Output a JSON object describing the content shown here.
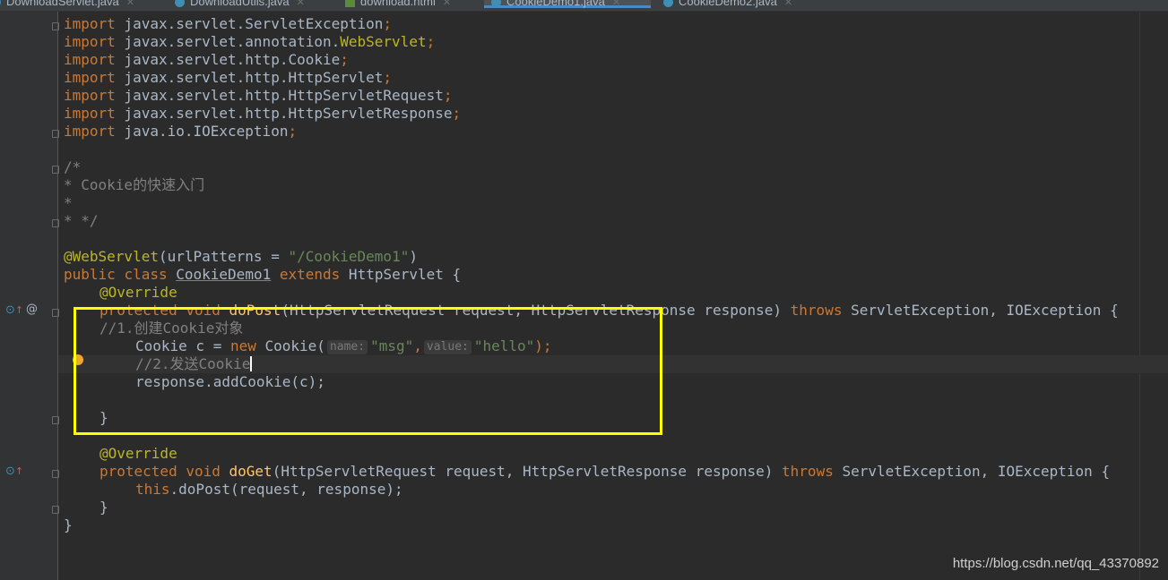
{
  "tabs": [
    {
      "label": "DownloadServlet.java"
    },
    {
      "label": "DownloadUtils.java"
    },
    {
      "label": "download.html"
    },
    {
      "label": "CookieDemo1.java"
    },
    {
      "label": "CookieDemo2.java"
    }
  ],
  "gutter": {
    "override_icon": "override-up-arrow-icon",
    "annotation_icon": "@"
  },
  "code": {
    "imports": [
      {
        "kw": "import",
        "pkg": " javax.servlet.ServletException",
        "ann": "",
        "semi": ";"
      },
      {
        "kw": "import",
        "pkg": " javax.servlet.annotation.",
        "ann": "WebServlet",
        "semi": ";"
      },
      {
        "kw": "import",
        "pkg": " javax.servlet.http.Cookie",
        "ann": "",
        "semi": ";"
      },
      {
        "kw": "import",
        "pkg": " javax.servlet.http.HttpServlet",
        "ann": "",
        "semi": ";"
      },
      {
        "kw": "import",
        "pkg": " javax.servlet.http.HttpServletRequest",
        "ann": "",
        "semi": ";"
      },
      {
        "kw": "import",
        "pkg": " javax.servlet.http.HttpServletResponse",
        "ann": "",
        "semi": ";"
      },
      {
        "kw": "import",
        "pkg": " java.io.IOException",
        "ann": "",
        "semi": ";"
      }
    ],
    "doc_comment": [
      "/*",
      "* Cookie的快速入门",
      "*",
      "* */"
    ],
    "annotation": {
      "name": "@WebServlet",
      "open": "(urlPatterns = ",
      "value": "\"/CookieDemo1\"",
      "close": ")"
    },
    "class_decl": {
      "public": "public",
      "class": "class",
      "name": "CookieDemo1",
      "extends": "extends",
      "parent": " HttpServlet {"
    },
    "override": "@Override",
    "doPost": {
      "protected": "protected",
      "void": "void",
      "name": "doPost",
      "params": "(HttpServletRequest request, HttpServletResponse response) ",
      "throws": "throws",
      "exceptions": " ServletException, IOException {"
    },
    "comment1": "//1.创建Cookie对象",
    "cookie_line": {
      "prefix": "Cookie c = ",
      "new": "new",
      "ctor": " Cookie(",
      "hint1": "name:",
      "arg1": "\"msg\"",
      "comma": ",",
      "hint2": "value:",
      "arg2": "\"hello\"",
      "suffix": ");"
    },
    "comment2": "//2.发送Cookie",
    "add_cookie": "response.addCookie(c);",
    "close_brace": "}",
    "doGet": {
      "protected": "protected",
      "void": "void",
      "name": "doGet",
      "params": "(HttpServletRequest request, HttpServletResponse response) ",
      "throws": "throws",
      "exceptions": " ServletException, IOException {"
    },
    "do_post_call": {
      "this": "this",
      "rest": ".doPost(request, response);"
    },
    "class_close": "}"
  },
  "watermark": "https://blog.csdn.net/qq_43370892",
  "colors": {
    "background": "#2b2b2b",
    "keyword": "#cc7832",
    "annotation": "#bbb529",
    "string": "#6a8759",
    "comment": "#808080",
    "highlight_box": "#ffff00"
  }
}
